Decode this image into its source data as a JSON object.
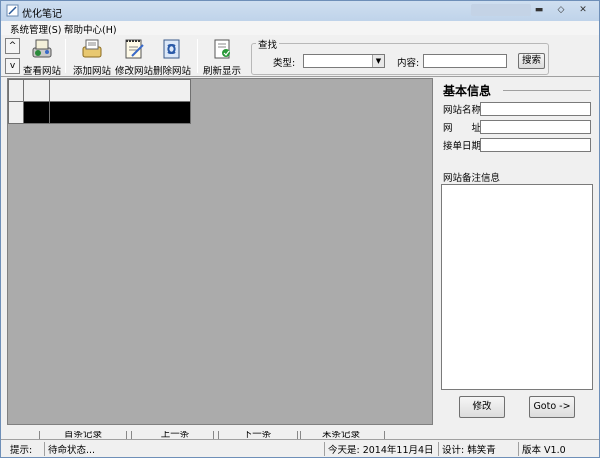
{
  "window": {
    "title": "优化笔记",
    "minimize_icon": "minimize-icon",
    "maximize_icon": "maximize-icon",
    "close_icon": "close-icon"
  },
  "menu": {
    "items": [
      {
        "label": "系统管理(S)"
      },
      {
        "label": "帮助中心(H)"
      }
    ]
  },
  "toolbar": {
    "scroll_up": "^",
    "scroll_down": "v",
    "buttons": [
      {
        "label": "查看网站",
        "icon": "view-icon"
      },
      {
        "label": "添加网站",
        "icon": "add-icon"
      },
      {
        "label": "修改网站",
        "icon": "edit-icon"
      },
      {
        "label": "删除网站",
        "icon": "delete-icon"
      },
      {
        "label": "刷新显示",
        "icon": "refresh-icon"
      }
    ]
  },
  "search": {
    "group_label": "查找",
    "type_label": "类型:",
    "type_value": "",
    "content_label": "内容:",
    "content_value": "",
    "button_label": "搜索"
  },
  "info_panel": {
    "title": "基本信息",
    "fields": [
      {
        "label": "网站名称",
        "value": ""
      },
      {
        "label": "网　　址",
        "value": ""
      },
      {
        "label": "接单日期",
        "value": ""
      }
    ],
    "notes_label": "网站备注信息",
    "notes_value": "",
    "edit_button": "修改",
    "goto_button": "Goto ->"
  },
  "navigation": {
    "first": "首条记录",
    "prev": "上一条",
    "next": "下一条",
    "last": "末条记录"
  },
  "status": {
    "tip_label": "提示:",
    "tip_value": "待命状态...",
    "date_text": "今天是: 2014年11月4日",
    "design_text": "设计: 韩笑青",
    "version_text": "版本 V1.0"
  },
  "colors": {
    "titlebar": "#c5d8ee",
    "selection": "#000000",
    "grid_background": "#ababab"
  }
}
